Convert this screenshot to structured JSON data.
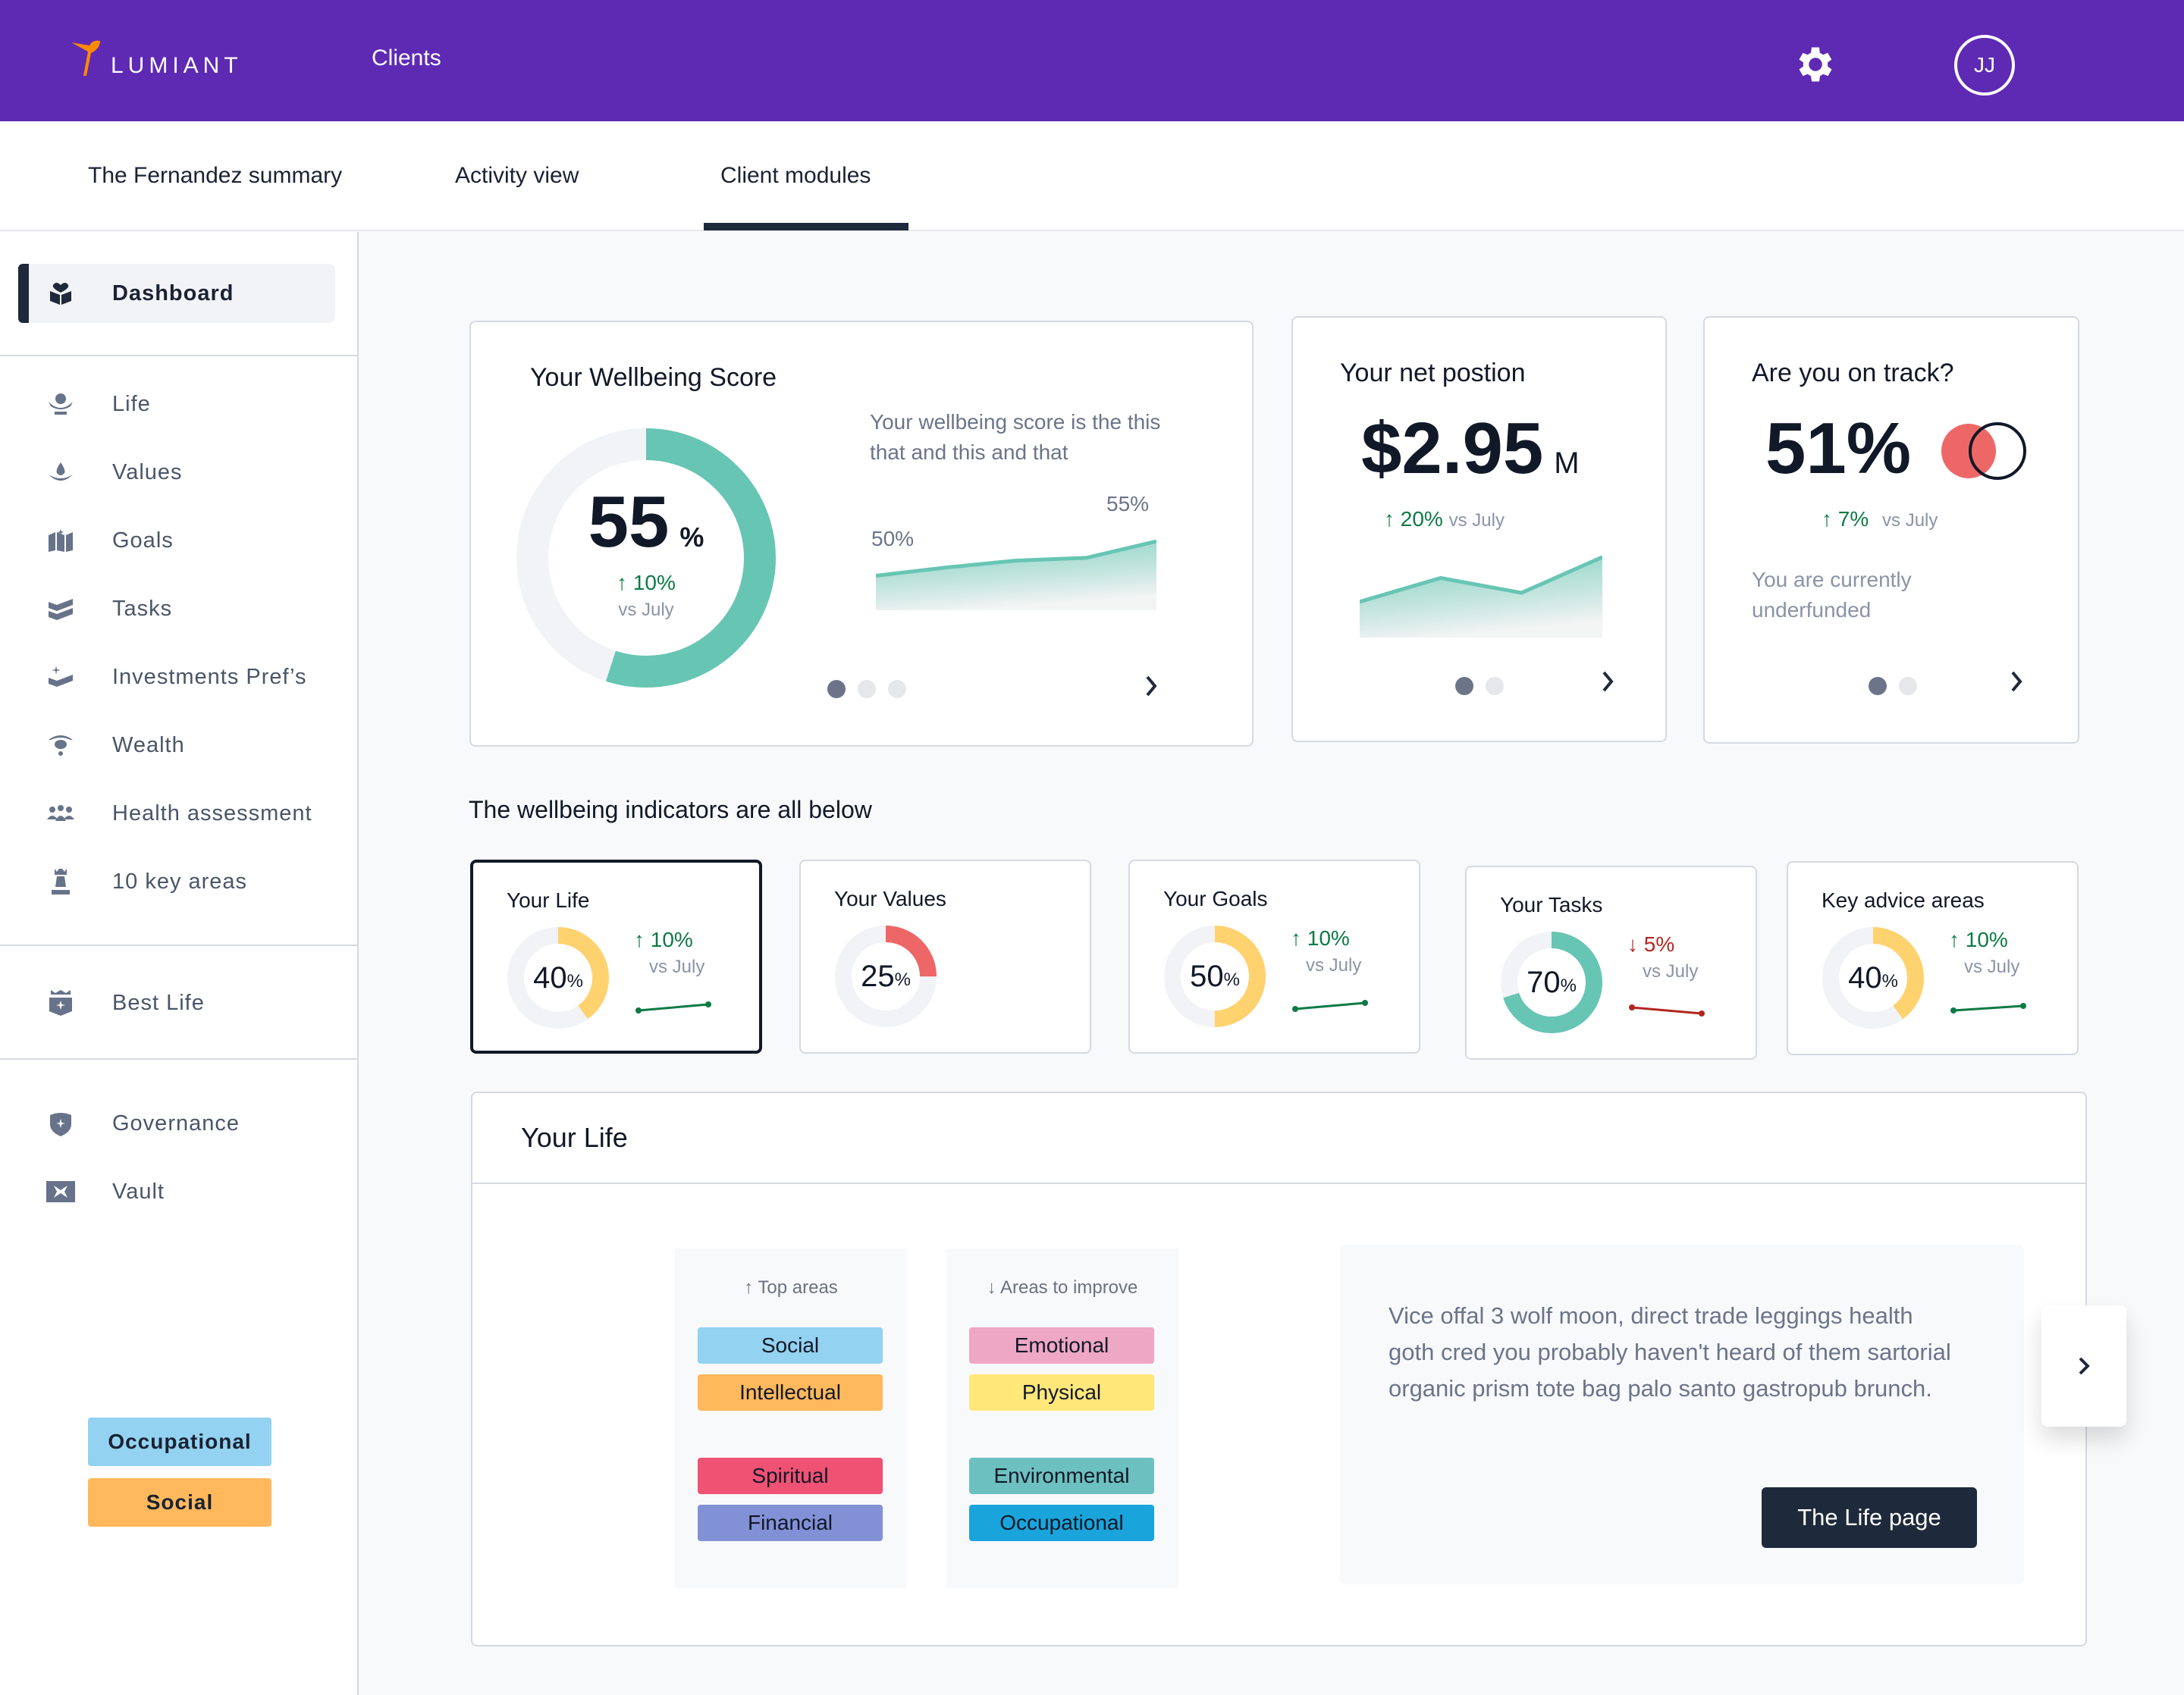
{
  "header": {
    "brand": "LUMIANT",
    "nav_clients": "Clients",
    "avatar_initials": "JJ",
    "brand_color": "#5E2AB4",
    "logo_accent": "#FF8A00"
  },
  "tabs": [
    {
      "label": "The Fernandez summary",
      "active": false
    },
    {
      "label": "Activity view",
      "active": false
    },
    {
      "label": "Client modules",
      "active": true
    }
  ],
  "sidebar": {
    "primary": {
      "label": "Dashboard",
      "icon": "dashboard-icon",
      "active": true
    },
    "items": [
      {
        "label": "Life",
        "icon": "life-icon"
      },
      {
        "label": "Values",
        "icon": "values-icon"
      },
      {
        "label": "Goals",
        "icon": "goals-icon"
      },
      {
        "label": "Tasks",
        "icon": "tasks-icon"
      },
      {
        "label": "Investments Pref’s",
        "icon": "investments-icon"
      },
      {
        "label": "Wealth",
        "icon": "wealth-icon"
      },
      {
        "label": "Health assessment",
        "icon": "health-icon"
      },
      {
        "label": "10 key areas",
        "icon": "key-areas-icon"
      }
    ],
    "best_life": {
      "label": "Best Life",
      "icon": "best-life-icon"
    },
    "secondary": [
      {
        "label": "Governance",
        "icon": "governance-icon"
      },
      {
        "label": "Vault",
        "icon": "vault-icon"
      }
    ],
    "tags": [
      {
        "label": "Occupational",
        "color": "#93D2F0"
      },
      {
        "label": "Social",
        "color": "#FFB85C"
      }
    ]
  },
  "wellbeing_card": {
    "title": "Your Wellbeing Score",
    "score": "55",
    "score_unit": "%",
    "score_fraction": 0.55,
    "delta": "10%",
    "delta_direction": "up",
    "vs": "vs July",
    "description": "Your wellbeing score is the this that and this and that",
    "start_label": "50%",
    "end_label": "55%",
    "carousel_page": 1,
    "carousel_pages": 3,
    "accent": "#67C5B3"
  },
  "net_card": {
    "title": "Your net postion",
    "value": "$2.95",
    "unit": "M",
    "delta": "20%",
    "delta_direction": "up",
    "vs": "vs July",
    "carousel_page": 1,
    "carousel_pages": 2
  },
  "track_card": {
    "title": "Are you on track?",
    "value": "51%",
    "delta": "7%",
    "delta_direction": "up",
    "vs": "vs July",
    "status": "You are currently underfunded",
    "carousel_page": 1,
    "carousel_pages": 2,
    "indicator_color": "#EE6767"
  },
  "indicators": {
    "heading": "The wellbeing indicators are all below",
    "items": [
      {
        "title": "Your Life",
        "value": "40",
        "fraction": 0.4,
        "color": "#FFD270",
        "delta": "10%",
        "direction": "up",
        "vs": "vs July",
        "selected": true
      },
      {
        "title": "Your Values",
        "value": "25",
        "fraction": 0.25,
        "color": "#EE6767",
        "delta": "",
        "direction": "",
        "vs": "",
        "selected": false
      },
      {
        "title": "Your Goals",
        "value": "50",
        "fraction": 0.5,
        "color": "#FFD270",
        "delta": "10%",
        "direction": "up",
        "vs": "vs July",
        "selected": false
      },
      {
        "title": "Your Tasks",
        "value": "70",
        "fraction": 0.7,
        "color": "#67C5B3",
        "delta": "5%",
        "direction": "down",
        "vs": "vs July",
        "selected": false
      },
      {
        "title": "Key advice areas",
        "value": "40",
        "fraction": 0.4,
        "color": "#FFD270",
        "delta": "10%",
        "direction": "up",
        "vs": "vs July",
        "selected": false
      }
    ],
    "percent_sign": "%"
  },
  "life_panel": {
    "title": "Your Life",
    "top_heading": "Top areas",
    "improve_heading": "Areas to improve",
    "top_areas": [
      {
        "label": "Social",
        "color": "#93D2F0"
      },
      {
        "label": "Intellectual",
        "color": "#FFB85C"
      },
      {
        "label": "Spiritual",
        "color": "#F05274"
      },
      {
        "label": "Financial",
        "color": "#8290D6"
      }
    ],
    "improve_areas": [
      {
        "label": "Emotional",
        "color": "#EEA7C4"
      },
      {
        "label": "Physical",
        "color": "#FFE77A"
      },
      {
        "label": "Environmental",
        "color": "#6CC0C0"
      },
      {
        "label": "Occupational",
        "color": "#19A5DC"
      }
    ],
    "description": "Vice offal 3 wolf moon, direct trade leggings health goth cred you probably haven't heard of them sartorial organic prism tote bag palo santo gastropub brunch.",
    "button_label": "The Life page"
  },
  "chart_data": [
    {
      "type": "area",
      "title": "Your Wellbeing Score trend",
      "x": [
        0,
        1,
        2,
        3,
        4
      ],
      "values": [
        50,
        51.2,
        52.2,
        52.6,
        55
      ],
      "annotations": [
        "50%",
        "55%"
      ],
      "ylim": [
        45,
        56
      ]
    },
    {
      "type": "area",
      "title": "Your net postion trend",
      "x": [
        0,
        1,
        2
      ],
      "values": [
        2.2,
        2.6,
        2.35,
        2.95
      ],
      "ylim": [
        1.6,
        3.0
      ]
    }
  ]
}
